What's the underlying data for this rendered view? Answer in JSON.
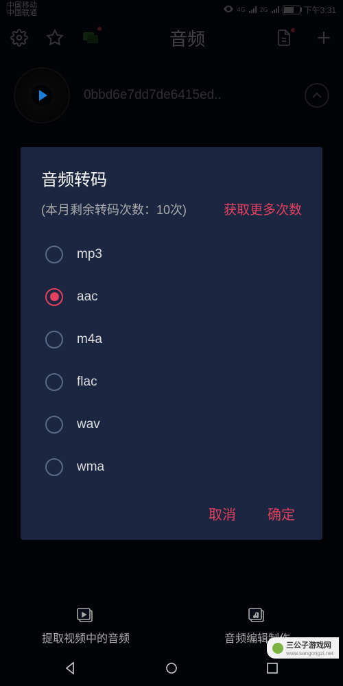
{
  "status": {
    "carrier1": "中国移动",
    "carrier2": "中国联通",
    "net1": "4G",
    "net2": "2G",
    "battery": "64",
    "time": "下午3:31"
  },
  "appbar": {
    "title": "音频"
  },
  "track": {
    "name": "0bbd6e7dd7de6415ed.."
  },
  "dialog": {
    "title": "音频转码",
    "subtitle": "(本月剩余转码次数：10次)",
    "more_link": "获取更多次数",
    "formats": {
      "0": "mp3",
      "1": "aac",
      "2": "m4a",
      "3": "flac",
      "4": "wav",
      "5": "wma"
    },
    "selected_index": 1,
    "cancel": "取消",
    "confirm": "确定"
  },
  "tabs": {
    "extract": "提取视频中的音频",
    "edit": "音频编辑制作"
  },
  "watermark": {
    "text": "三公子游戏网",
    "url": "www.sangongzi.net"
  },
  "colors": {
    "accent": "#e4405f",
    "dialog_bg": "#1b2640"
  }
}
